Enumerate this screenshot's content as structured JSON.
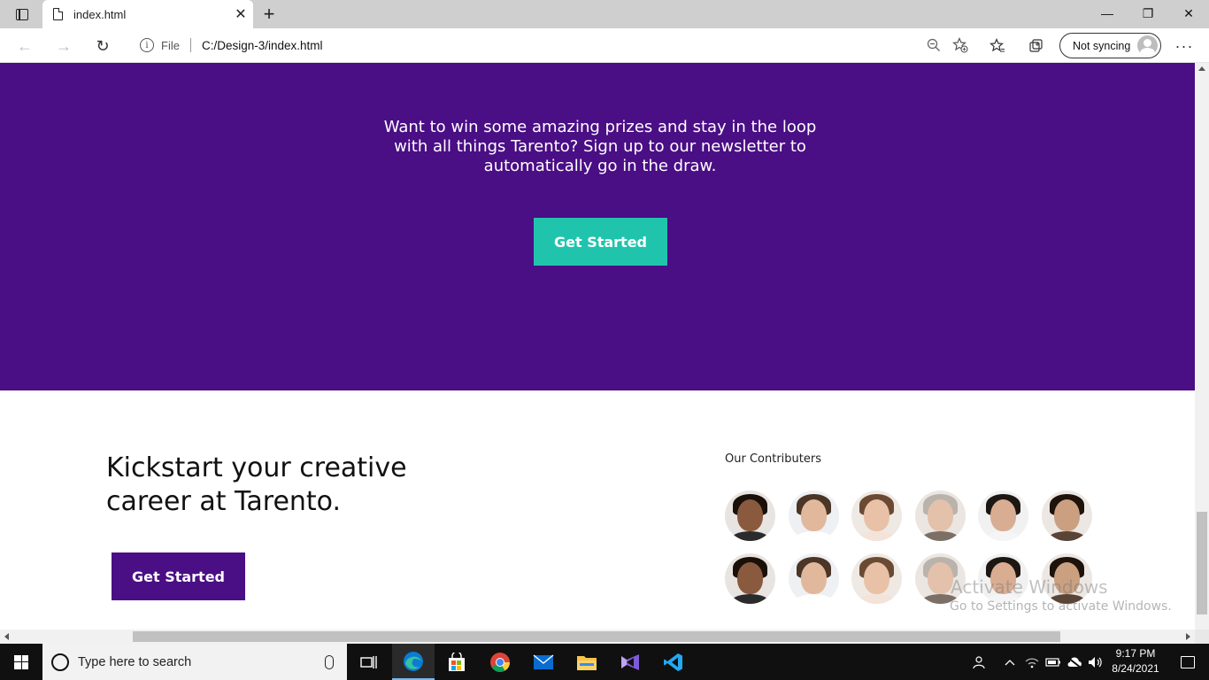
{
  "browser": {
    "tab_title": "index.html",
    "tab_close": "✕",
    "new_tab": "+",
    "address_scheme": "File",
    "address_url": "C:/Design-3/index.html",
    "sync_label": "Not syncing",
    "more_label": "···",
    "window_controls": {
      "minimize": "—",
      "restore": "❐",
      "close": "✕"
    }
  },
  "page": {
    "newsletter_text": "Want to win some amazing prizes and stay in the loop with all things Tarento? Sign up to our newsletter to automatically go in the draw.",
    "hero_button": "Get Started",
    "kickstart_heading": "Kickstart your creative career at Tarento.",
    "kickstart_button": "Get Started",
    "contributors_title": "Our Contributers",
    "contributors": [
      {
        "skin": "#8a5a3e",
        "hair": "#1a1008",
        "body": "#2b2b2b",
        "bg": "#e8e4e1"
      },
      {
        "skin": "#e2b89c",
        "hair": "#4a3526",
        "body": "#ffffff",
        "bg": "#eef0f3"
      },
      {
        "skin": "#e9c1a7",
        "hair": "#6b4a33",
        "body": "#f3e3d8",
        "bg": "#efe9e3"
      },
      {
        "skin": "#e4c1aa",
        "hair": "#b9b3ab",
        "body": "#7c6f66",
        "bg": "#ebe6e2"
      },
      {
        "skin": "#d9ad92",
        "hair": "#1d1714",
        "body": "#f5f5f5",
        "bg": "#f1f1f1"
      },
      {
        "skin": "#caa081",
        "hair": "#1e120b",
        "body": "#5a4436",
        "bg": "#ece7e3"
      }
    ],
    "colors": {
      "purple": "#4a0e85",
      "teal": "#20c4ad"
    }
  },
  "watermark": {
    "line1": "Activate Windows",
    "line2": "Go to Settings to activate Windows."
  },
  "taskbar": {
    "search_placeholder": "Type here to search",
    "time": "9:17 PM",
    "date": "8/24/2021",
    "apps": [
      "task-view-icon",
      "edge-icon",
      "store-icon",
      "chrome-icon",
      "mail-icon",
      "file-explorer-icon",
      "visual-studio-icon",
      "vscode-icon"
    ]
  }
}
